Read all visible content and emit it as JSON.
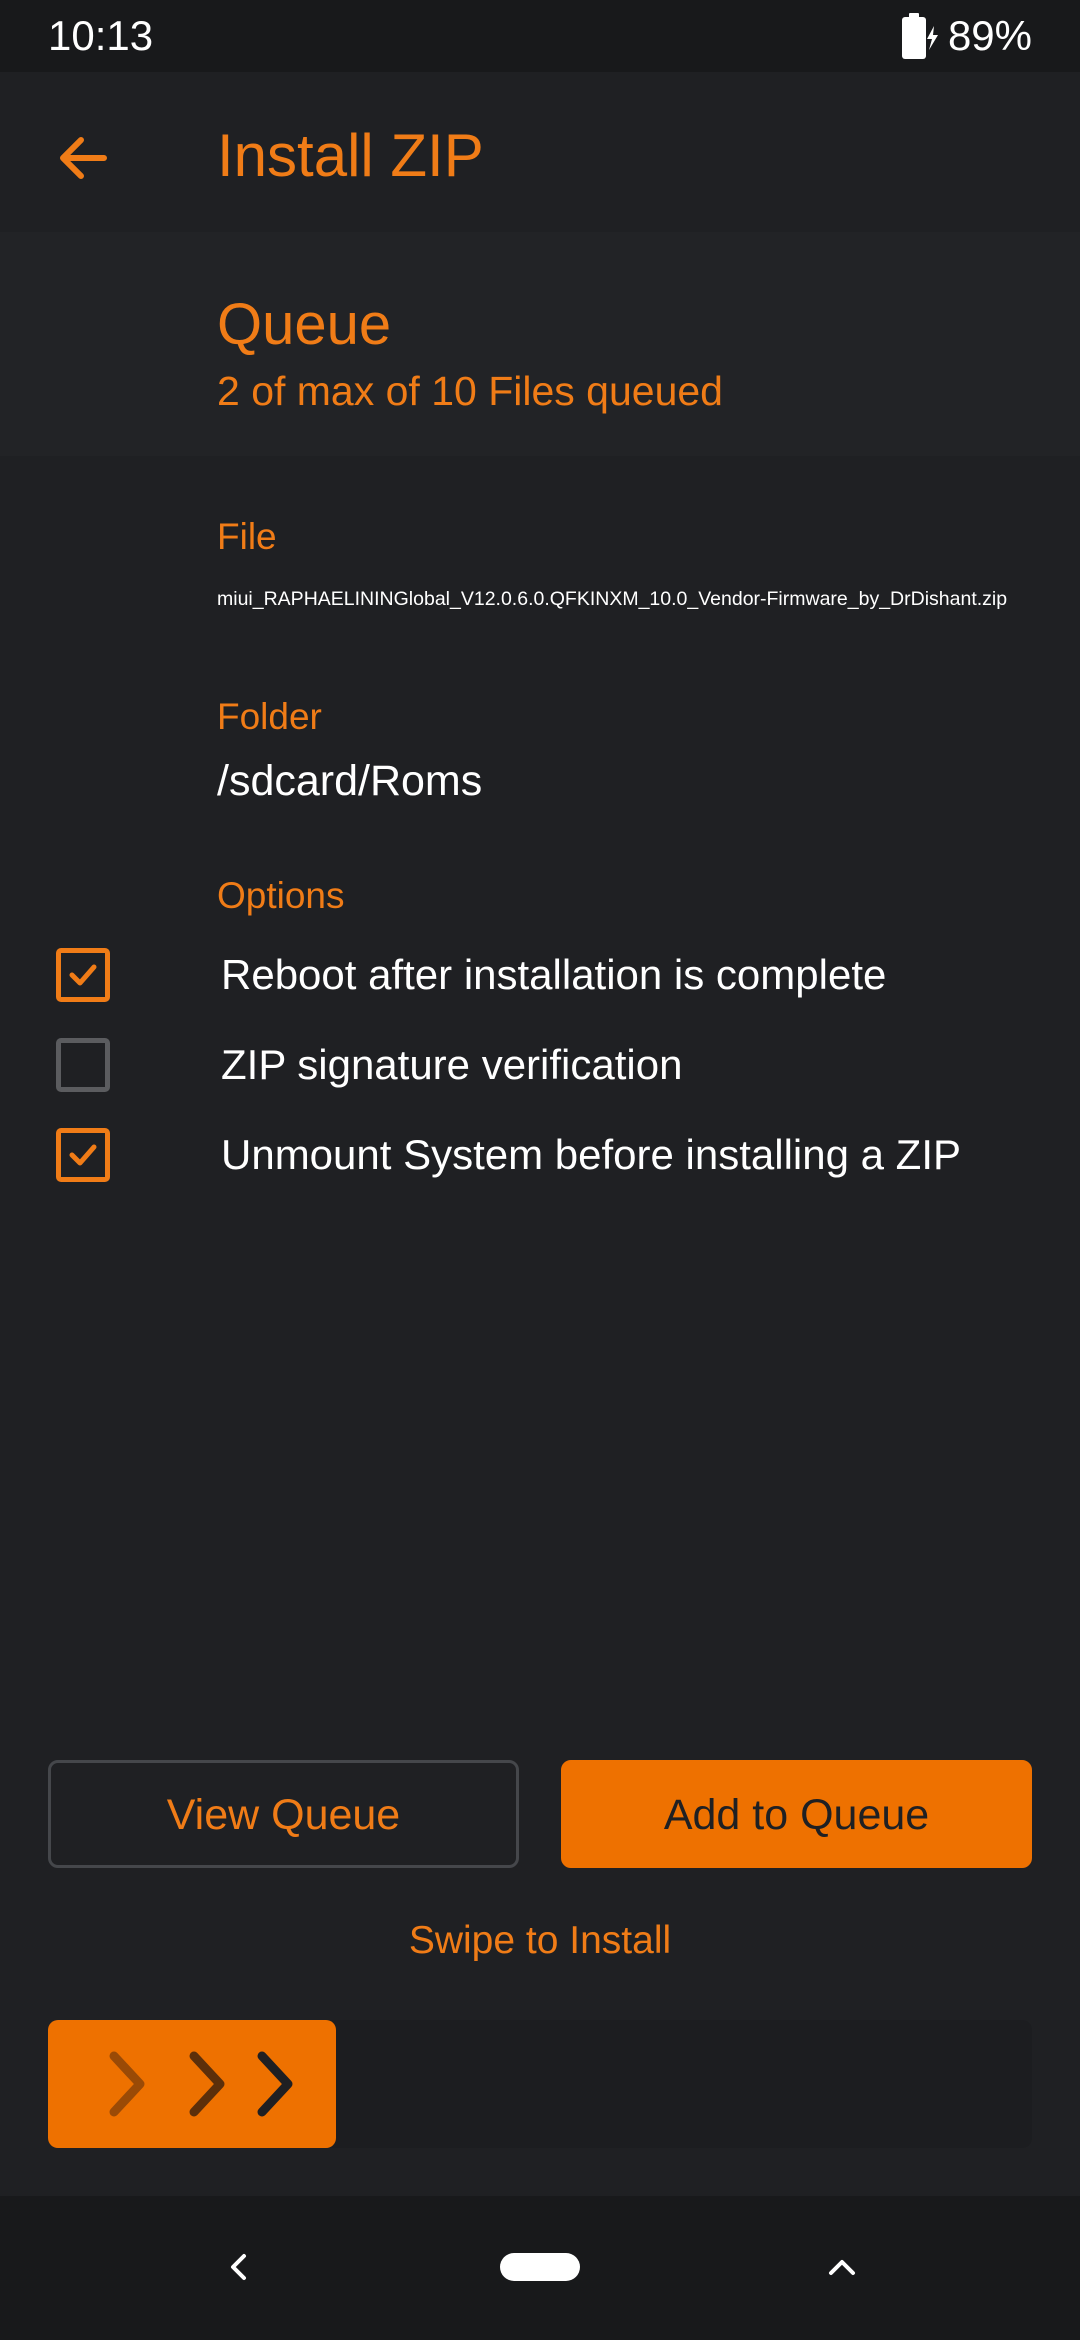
{
  "status_bar": {
    "time": "10:13",
    "battery_percent": "89%",
    "battery_icon": "battery-charging-icon"
  },
  "header": {
    "back_icon": "arrow-left-icon",
    "title": "Install ZIP"
  },
  "queue": {
    "title": "Queue",
    "subtitle": "2 of max of 10 Files queued"
  },
  "file": {
    "label": "File",
    "name": "miui_RAPHAELININGlobal_V12.0.6.0.QFKINXM_10.0_Vendor-Firmware_by_DrDishant.zip"
  },
  "folder": {
    "label": "Folder",
    "path": "/sdcard/Roms"
  },
  "options": {
    "label": "Options",
    "items": [
      {
        "label": "Reboot after installation is complete",
        "checked": true
      },
      {
        "label": "ZIP signature verification",
        "checked": false
      },
      {
        "label": "Unmount System before installing a ZIP",
        "checked": true
      }
    ]
  },
  "buttons": {
    "view_queue": "View Queue",
    "add_to_queue": "Add to Queue"
  },
  "swipe": {
    "label": "Swipe to Install",
    "handle_icon": "triple-chevron-right-icon"
  },
  "nav_bar": {
    "back_icon": "nav-back-icon",
    "home_icon": "nav-home-pill-icon",
    "recents_icon": "nav-up-chevron-icon"
  },
  "colors": {
    "accent": "#f07c17",
    "accent_fill": "#ee7100",
    "background": "#1f2023",
    "text": "#ffffff",
    "checkbox_off": "#5b5c5f"
  }
}
